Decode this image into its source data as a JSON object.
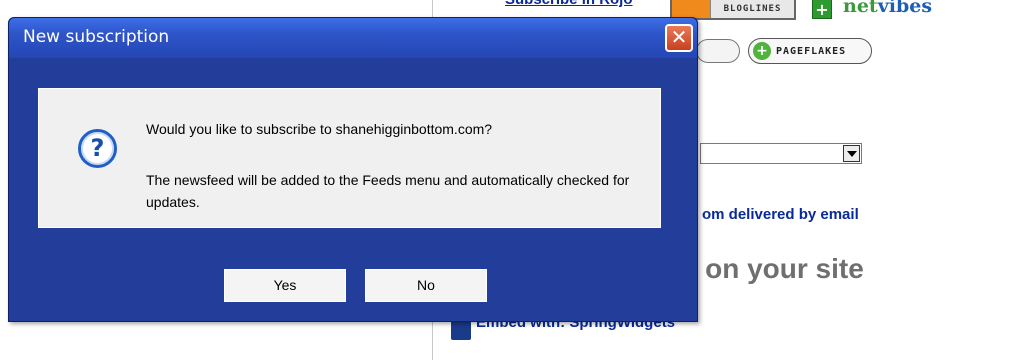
{
  "background": {
    "subscribe_text": "Subscribe in Rojo",
    "bloglines_label": "BLOGLINES",
    "netvibes_plus": "+",
    "netvibes_part1": "net",
    "netvibes_part2": "vibes",
    "pageflakes_label": "PAGEFLAKES",
    "email_link": "om delivered by email",
    "site_heading": "t on your site",
    "embed_text": "Embed with: SpringWidgets"
  },
  "dialog": {
    "title": "New subscription",
    "close_glyph": "✕",
    "icon_glyph": "?",
    "message_line1": "Would you like to subscribe to shanehigginbottom.com?",
    "message_line2": "The newsfeed will be added to the Feeds menu and automatically checked for updates.",
    "yes_label": "Yes",
    "no_label": "No"
  },
  "colors": {
    "dialog_body": "#223d9a",
    "titlebar": "#2e55c8",
    "close_button": "#c8401f",
    "link": "#0a2a9a"
  },
  "icons": {
    "close": "close-icon",
    "question": "question-icon",
    "dropdown": "chevron-down-icon",
    "embed": "embed-icon"
  }
}
